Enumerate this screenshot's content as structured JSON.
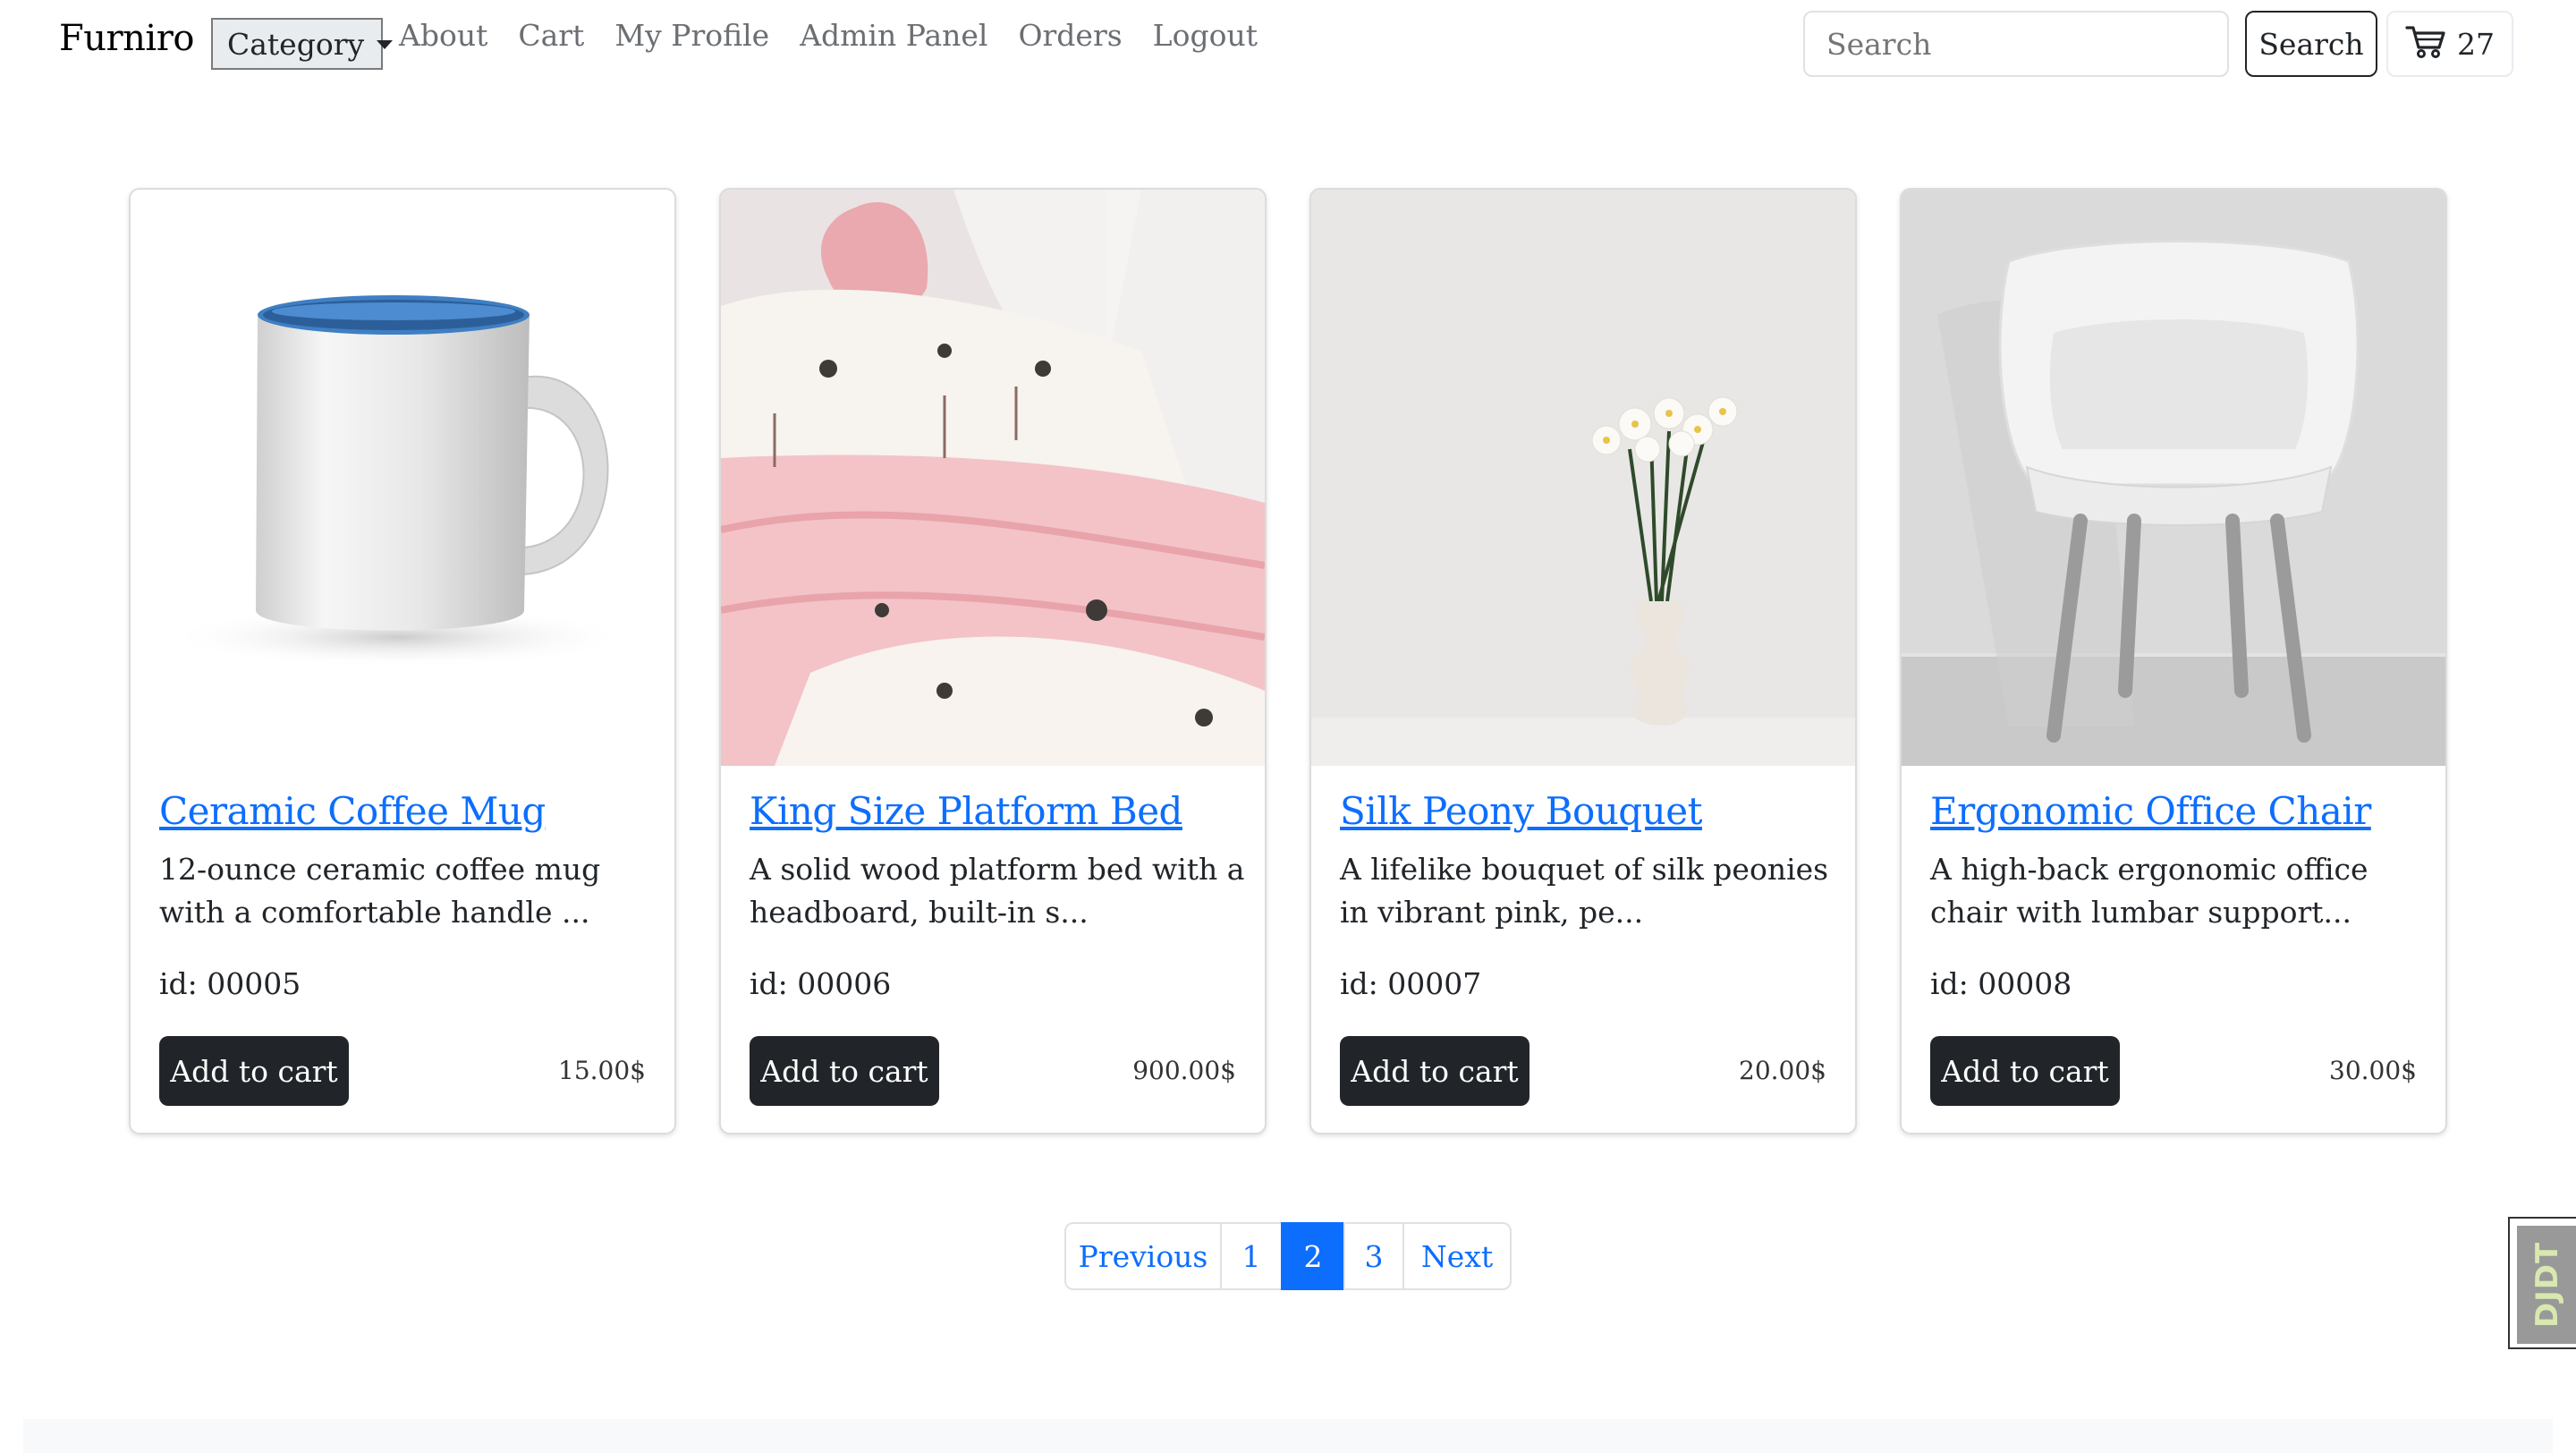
{
  "nav": {
    "brand": "Furniro",
    "category_label": "Category",
    "links": [
      "About",
      "Cart",
      "My Profile",
      "Admin Panel",
      "Orders",
      "Logout"
    ],
    "search_placeholder": "Search",
    "search_button": "Search",
    "cart_count": "27"
  },
  "products": [
    {
      "title": "Ceramic Coffee Mug",
      "description": "12-ounce ceramic coffee mug with a comfortable handle ...",
      "id_text": "id: 00005",
      "add_label": "Add to cart",
      "price": "15.00$"
    },
    {
      "title": "King Size Platform Bed",
      "description": "A solid wood platform bed with a headboard, built-in s...",
      "id_text": "id: 00006",
      "add_label": "Add to cart",
      "price": "900.00$"
    },
    {
      "title": "Silk Peony Bouquet",
      "description": "A lifelike bouquet of silk peonies in vibrant pink, pe...",
      "id_text": "id: 00007",
      "add_label": "Add to cart",
      "price": "20.00$"
    },
    {
      "title": "Ergonomic Office Chair",
      "description": "A high-back ergonomic office chair with lumbar support...",
      "id_text": "id: 00008",
      "add_label": "Add to cart",
      "price": "30.00$"
    }
  ],
  "pagination": {
    "previous": "Previous",
    "pages": [
      "1",
      "2",
      "3"
    ],
    "active_page": "2",
    "next": "Next"
  },
  "debug_toolbar": {
    "label": "DJDT"
  },
  "colors": {
    "link": "#0d6efd",
    "button_dark": "#212529",
    "active_page": "#0d6efd"
  }
}
